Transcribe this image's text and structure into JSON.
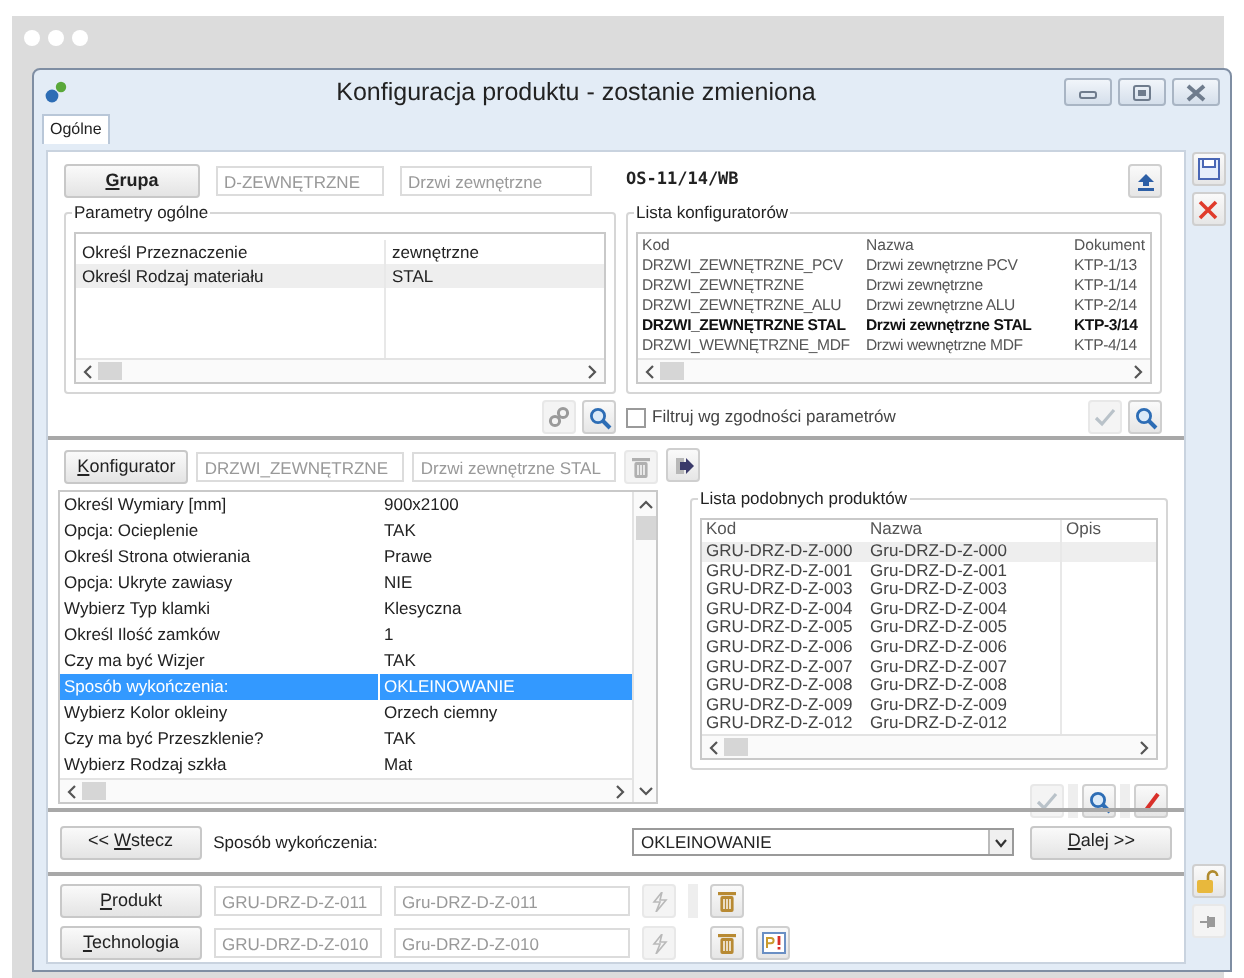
{
  "window": {
    "title": "Konfiguracja produktu - zostanie zmieniona"
  },
  "tabs": [
    {
      "label": "Ogólne",
      "selected": true
    }
  ],
  "group": {
    "button": "Grupa",
    "code": "D-ZEWNĘTRZNE",
    "name": "Drzwi zewnętrzne"
  },
  "document_number": "OS-11/14/WB",
  "general_parameters": {
    "title": "Parametry ogólne",
    "rows": [
      {
        "name": "Określ Przeznaczenie",
        "value": "zewnętrzne",
        "selected": false
      },
      {
        "name": "Określ Rodzaj materiału",
        "value": "STAL",
        "selected": true
      }
    ]
  },
  "configurator_list": {
    "title": "Lista konfiguratorów",
    "columns": [
      "Kod",
      "Nazwa",
      "Dokument"
    ],
    "rows": [
      {
        "cells": [
          "DRZWI_ZEWNĘTRZNE_PCV",
          "Drzwi zewnętrzne PCV",
          "KTP-1/13"
        ],
        "selected": false
      },
      {
        "cells": [
          "DRZWI_ZEWNĘTRZNE",
          "Drzwi zewnętrzne",
          "KTP-1/14"
        ],
        "selected": false
      },
      {
        "cells": [
          "DRZWI_ZEWNĘTRZNE_ALU",
          "Drzwi zewnętrzne ALU",
          "KTP-2/14"
        ],
        "selected": false
      },
      {
        "cells": [
          "DRZWI_ZEWNĘTRZNE STAL",
          "Drzwi zewnętrzne STAL",
          "KTP-3/14"
        ],
        "selected": true
      },
      {
        "cells": [
          "DRZWI_WEWNĘTRZNE_MDF",
          "Drzwi wewnętrzne MDF",
          "KTP-4/14"
        ],
        "selected": false
      }
    ]
  },
  "filter": {
    "label": "Filtruj wg zgodności parametrów",
    "checked": false
  },
  "configurator": {
    "button": "Konfigurator",
    "code": "DRZWI_ZEWNĘTRZNE",
    "name": "Drzwi zewnętrzne STAL"
  },
  "config_parameters": [
    {
      "name": "Określ Wymiary [mm]",
      "value": "900x2100",
      "selected": false
    },
    {
      "name": "Opcja: Ocieplenie",
      "value": "TAK",
      "selected": false
    },
    {
      "name": "Określ Strona otwierania",
      "value": "Prawe",
      "selected": false
    },
    {
      "name": "Opcja: Ukryte zawiasy",
      "value": "NIE",
      "selected": false
    },
    {
      "name": "Wybierz Typ klamki",
      "value": "Klesyczna",
      "selected": false
    },
    {
      "name": "Określ Ilość zamków",
      "value": "1",
      "selected": false
    },
    {
      "name": "Czy ma być Wizjer",
      "value": "TAK",
      "selected": false
    },
    {
      "name": "Sposób wykończenia:",
      "value": "OKLEINOWANIE",
      "selected": true
    },
    {
      "name": "Wybierz Kolor okleiny",
      "value": "Orzech ciemny",
      "selected": false
    },
    {
      "name": "Czy ma być Przeszklenie?",
      "value": "TAK",
      "selected": false
    },
    {
      "name": "Wybierz Rodzaj szkła",
      "value": "Mat",
      "selected": false
    }
  ],
  "similar_products": {
    "title": "Lista podobnych produktów",
    "columns": [
      "Kod",
      "Nazwa",
      "Opis"
    ],
    "rows": [
      {
        "cells": [
          "GRU-DRZ-D-Z-000",
          "Gru-DRZ-D-Z-000"
        ],
        "selected": true
      },
      {
        "cells": [
          "GRU-DRZ-D-Z-001",
          "Gru-DRZ-D-Z-001"
        ],
        "selected": false
      },
      {
        "cells": [
          "GRU-DRZ-D-Z-003",
          "Gru-DRZ-D-Z-003"
        ],
        "selected": false
      },
      {
        "cells": [
          "GRU-DRZ-D-Z-004",
          "Gru-DRZ-D-Z-004"
        ],
        "selected": false
      },
      {
        "cells": [
          "GRU-DRZ-D-Z-005",
          "Gru-DRZ-D-Z-005"
        ],
        "selected": false
      },
      {
        "cells": [
          "GRU-DRZ-D-Z-006",
          "Gru-DRZ-D-Z-006"
        ],
        "selected": false
      },
      {
        "cells": [
          "GRU-DRZ-D-Z-007",
          "Gru-DRZ-D-Z-007"
        ],
        "selected": false
      },
      {
        "cells": [
          "GRU-DRZ-D-Z-008",
          "Gru-DRZ-D-Z-008"
        ],
        "selected": false
      },
      {
        "cells": [
          "GRU-DRZ-D-Z-009",
          "Gru-DRZ-D-Z-009"
        ],
        "selected": false
      },
      {
        "cells": [
          "GRU-DRZ-D-Z-012",
          "Gru-DRZ-D-Z-012"
        ],
        "selected": false
      }
    ]
  },
  "step": {
    "back": "<< Wstecz",
    "label": "Sposób wykończenia:",
    "value": "OKLEINOWANIE",
    "next": "Dalej >>"
  },
  "product": {
    "button": "Produkt",
    "code": "GRU-DRZ-D-Z-011",
    "name": "Gru-DRZ-D-Z-011"
  },
  "technology": {
    "button": "Technologia",
    "code": "GRU-DRZ-D-Z-010",
    "name": "Gru-DRZ-D-Z-010"
  }
}
